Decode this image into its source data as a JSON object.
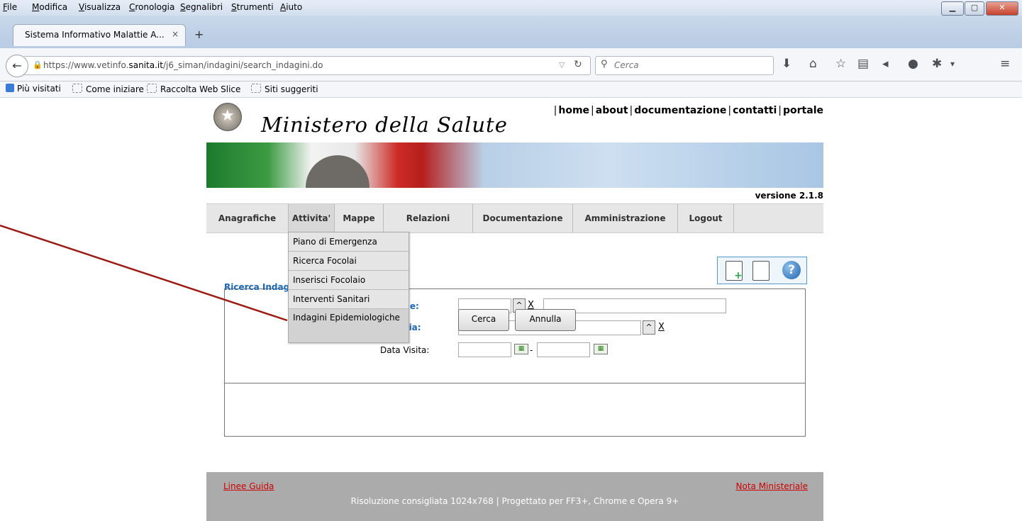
{
  "browser": {
    "menu": [
      "File",
      "Modifica",
      "Visualizza",
      "Cronologia",
      "Segnalibri",
      "Strumenti",
      "Aiuto"
    ],
    "tab_title": "Sistema Informativo Malattie A...",
    "tab_close": "×",
    "new_tab": "+",
    "url_prefix": "https://www.vetinfo.",
    "url_domain": "sanita.it",
    "url_path": "/j6_siman/indagini/search_indagini.do",
    "search_placeholder": "Cerca",
    "bookmarks": [
      "Più visitati",
      "Come iniziare",
      "Raccolta Web Slice",
      "Siti suggeriti"
    ]
  },
  "page": {
    "logo_text": "Ministero della Salute",
    "top_links": [
      "home",
      "about",
      "documentazione",
      "contatti",
      "portale"
    ],
    "version": "versione 2.1.8",
    "nav": [
      "Anagrafiche",
      "Attivita'",
      "Mappe",
      "Relazioni",
      "Documentazione",
      "Amministrazione",
      "Logout"
    ],
    "dropdown": [
      "Piano di Emergenza",
      "Ricerca Focolai",
      "Inserisci Focolaio",
      "Interventi Sanitari",
      "Indagini Epidemiologiche"
    ],
    "fieldset_legend": "Ricerca Indag",
    "labels": {
      "row1_partial": "ione:",
      "row2_partial": "attia:",
      "data_visita": "Data Visita:"
    },
    "picker_glyph": "^",
    "clear_glyph": "X",
    "date_sep": "-",
    "buttons": {
      "search": "Cerca",
      "cancel": "Annulla"
    },
    "footer": {
      "left_link": "Linee Guida",
      "right_link": "Nota Ministeriale",
      "center": "Risoluzione consigliata 1024x768 | Progettato per FF3+, Chrome e Opera 9+"
    }
  },
  "colors": {
    "annotation_line": "#9b1b14",
    "link_blue": "#1c66b3",
    "footer_link": "#cc0000"
  }
}
